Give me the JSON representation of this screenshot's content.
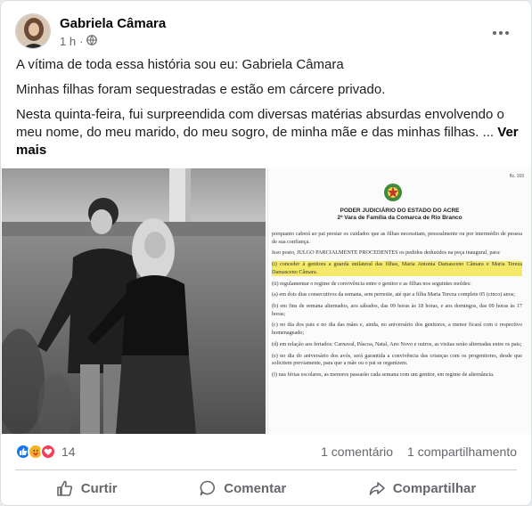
{
  "post": {
    "author": "Gabriela Câmara",
    "time": "1 h",
    "more_label": "···",
    "paragraphs": [
      "A vítima de toda essa história sou eu: Gabriela Câmara",
      "Minhas filhas foram sequestradas e estão em cárcere privado.",
      "Nesta quinta-feira, fui surpreendida com diversas matérias absurdas envolvendo o meu nome, do meu marido, do meu sogro, de minha mãe e das minhas filhas. ..."
    ],
    "see_more": "Ver mais"
  },
  "document": {
    "page_no": "fls. 169",
    "header1": "PODER JUDICIÁRIO DO ESTADO DO ACRE",
    "header2": "2ª Vara de Família da Comarca de Rio Branco",
    "lines": [
      "porquanto caberá ao pai prestar os cuidados que as filhas necessitam, pessoalmente ou por intermédio de pessoa de sua confiança.",
      "Isso posto, JULGO PARCIALMENTE PROCEDENTES os pedidos deduzidos na peça inaugural, para:",
      "(i) conceder à genitora a guarda unilateral das filhas, Maria Antonia Damasceno Câmara e Maria Tereza Damasceno Câmara.",
      "(ii) regulamentar o regime de convivência entre o genitor e as filhas nos seguintes moldes:",
      "(a) em dois dias consecutivos da semana, sem pernoite, até que a filha Maria Tereza complete 05 (cinco) anos;",
      "(b) em fins de semana alternados, aos sábados, das 09 horas às 18 horas, e aos domingos, das 09 horas às 17 horas;",
      "(c) no dia dos pais e no dia das mães e, ainda, no aniversário dos genitores, a menor ficará com o respectivo homenageado;",
      "(d) em relação aos feriados: Carnaval, Páscoa, Natal, Ano Novo e outros, as visitas serão alternadas entre os pais;",
      "(e) no dia do aniversário dos avós, será garantida a convivência das crianças com os progenitores, desde que solicitem previamente, para que a mãe ou o pai se organizem.",
      "(f) nas férias escolares, as menores passarão cada semana com um genitor, em regime de alternância."
    ]
  },
  "stats": {
    "reaction_count": "14",
    "comments": "1 comentário",
    "shares": "1 compartilhamento"
  },
  "actions": {
    "like": "Curtir",
    "comment": "Comentar",
    "share": "Compartilhar"
  },
  "colors": {
    "like_blue": "#1877f2",
    "love_red": "#f33e58",
    "care_yellow": "#f7b125",
    "muted": "#65676b",
    "highlight": "#f5e96a"
  }
}
